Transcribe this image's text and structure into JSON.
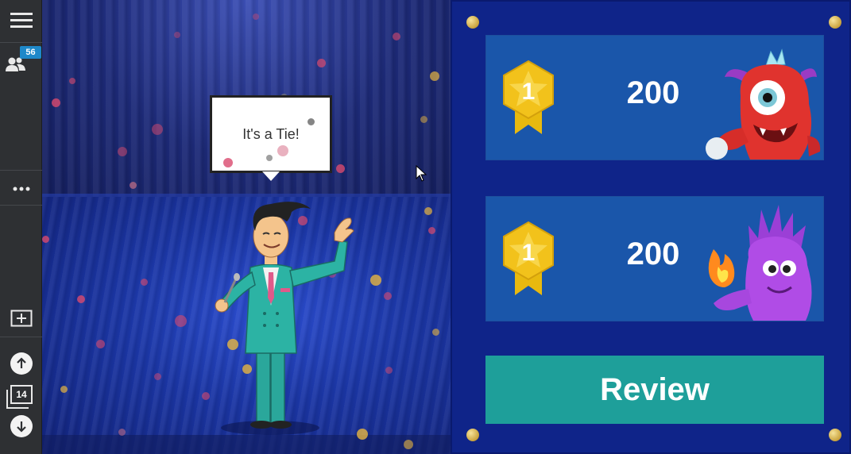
{
  "toolbar": {
    "participants_count": "56",
    "page_number": "14",
    "icons": [
      "menu-icon",
      "participants-icon",
      "more-icon",
      "add-slide-icon",
      "arrow-up-icon",
      "pages-icon",
      "arrow-down-icon"
    ]
  },
  "stage": {
    "speech_bubble": "It's a Tie!"
  },
  "scoreboard": {
    "teams": [
      {
        "rank": "1",
        "score": "200",
        "avatar": "red-monster"
      },
      {
        "rank": "1",
        "score": "200",
        "avatar": "purple-monster"
      }
    ],
    "review_label": "Review"
  },
  "colors": {
    "panel_bg": "#0f2489",
    "card_bg": "#1a56aa",
    "review_bg": "#1e9f9a",
    "medal_gold": "#f2c21b"
  }
}
